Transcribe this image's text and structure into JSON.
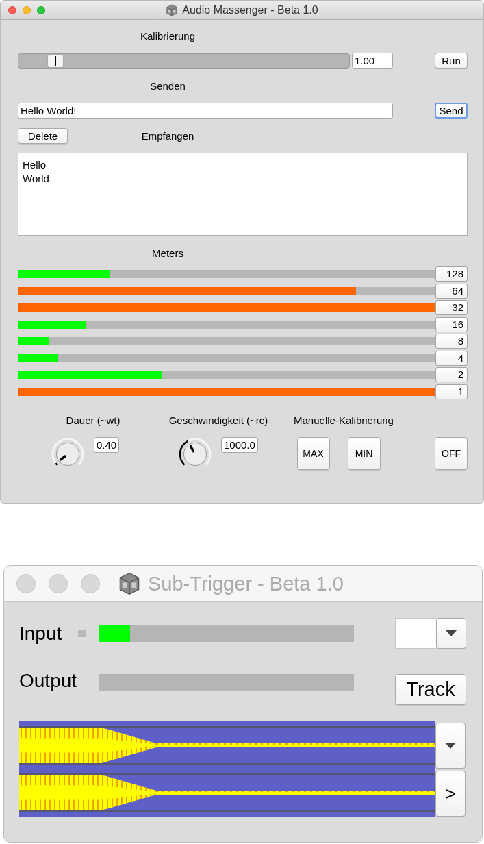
{
  "main_window": {
    "title": "Audio Massenger - Beta 1.0",
    "active": true,
    "calibration": {
      "label": "Kalibrierung",
      "value": "1.00",
      "button": {
        "label": "Run",
        "focused": false
      }
    },
    "send": {
      "label": "Senden",
      "value": "Hello World!",
      "button": {
        "label": "Send",
        "focused": true
      }
    },
    "receive": {
      "delete_button": {
        "label": "Delete",
        "focused": false
      },
      "label": "Empfangen",
      "lines": [
        "Hello",
        "World"
      ]
    },
    "meters": {
      "label": "Meters",
      "rows": [
        {
          "reading": "128",
          "level": 0.22,
          "color": "#00ff00"
        },
        {
          "reading": "64",
          "level": 0.81,
          "color": "#ff6600"
        },
        {
          "reading": "32",
          "level": 1,
          "color": "#ff6600"
        },
        {
          "reading": "16",
          "level": 0.164,
          "color": "#00ff00"
        },
        {
          "reading": "8",
          "level": 0.074,
          "color": "#00ff00"
        },
        {
          "reading": "4",
          "level": 0.095,
          "color": "#00ff00"
        },
        {
          "reading": "2",
          "level": 0.344,
          "color": "#00ff00"
        },
        {
          "reading": "1",
          "level": 1,
          "color": "#ff6600"
        }
      ]
    },
    "dials": [
      {
        "label": "Dauer (~wt)",
        "value": "0.40"
      },
      {
        "label": "Geschwindigkeit (~rc)",
        "value": "1000.0"
      }
    ],
    "manual": {
      "label": "Manuelle-Kalibrierung",
      "buttons": [
        {
          "label": "MAX",
          "focused": false
        },
        {
          "label": "MIN",
          "focused": false
        }
      ]
    },
    "off_button": {
      "label": "OFF",
      "focused": false
    }
  },
  "trigger_window": {
    "title": "Sub-Trigger - Beta 1.0",
    "active": false,
    "input": {
      "label": "Input",
      "indicator_on": false,
      "level": 0.12
    },
    "output": {
      "label": "Output",
      "level": 0
    },
    "track_button": {
      "label": "Track",
      "focused": false
    },
    "next_button": {
      "label": ">",
      "focused": false
    }
  }
}
